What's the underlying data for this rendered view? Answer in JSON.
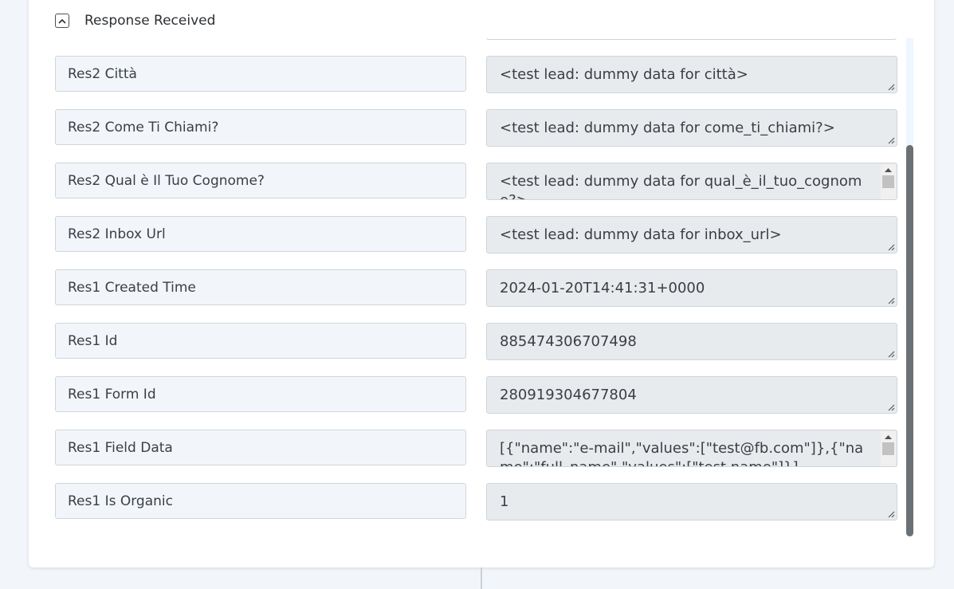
{
  "section": {
    "title": "Response Received"
  },
  "fields": [
    {
      "label": "Res2 Città",
      "value": "<test lead: dummy data for città>",
      "scroll": false
    },
    {
      "label": "Res2 Come Ti Chiami?",
      "value": "<test lead: dummy data for come_ti_chiami?>",
      "scroll": false
    },
    {
      "label": "Res2 Qual è Il Tuo Cognome?",
      "value": "<test lead: dummy data for qual_è_il_tuo_cognome?>",
      "scroll": true
    },
    {
      "label": "Res2 Inbox Url",
      "value": "<test lead: dummy data for inbox_url>",
      "scroll": false
    },
    {
      "label": "Res1 Created Time",
      "value": "2024-01-20T14:41:31+0000",
      "scroll": false
    },
    {
      "label": "Res1 Id",
      "value": "885474306707498",
      "scroll": false
    },
    {
      "label": "Res1 Form Id",
      "value": "280919304677804",
      "scroll": false
    },
    {
      "label": "Res1 Field Data",
      "value": "[{\"name\":\"e-mail\",\"values\":[\"test@fb.com\"]},{\"name\":\"full_name\",\"values\":[\"test name\"]}]",
      "scroll": true
    },
    {
      "label": "Res1 Is Organic",
      "value": "1",
      "scroll": false
    }
  ],
  "icons": {
    "collapse": "chevron-up-icon",
    "resize": "resize-grip-icon"
  },
  "colors": {
    "label_bg": "#f2f6fa",
    "value_bg": "#e8ebee",
    "border": "#cfd5dc",
    "scroll_thumb": "#6b7075"
  }
}
